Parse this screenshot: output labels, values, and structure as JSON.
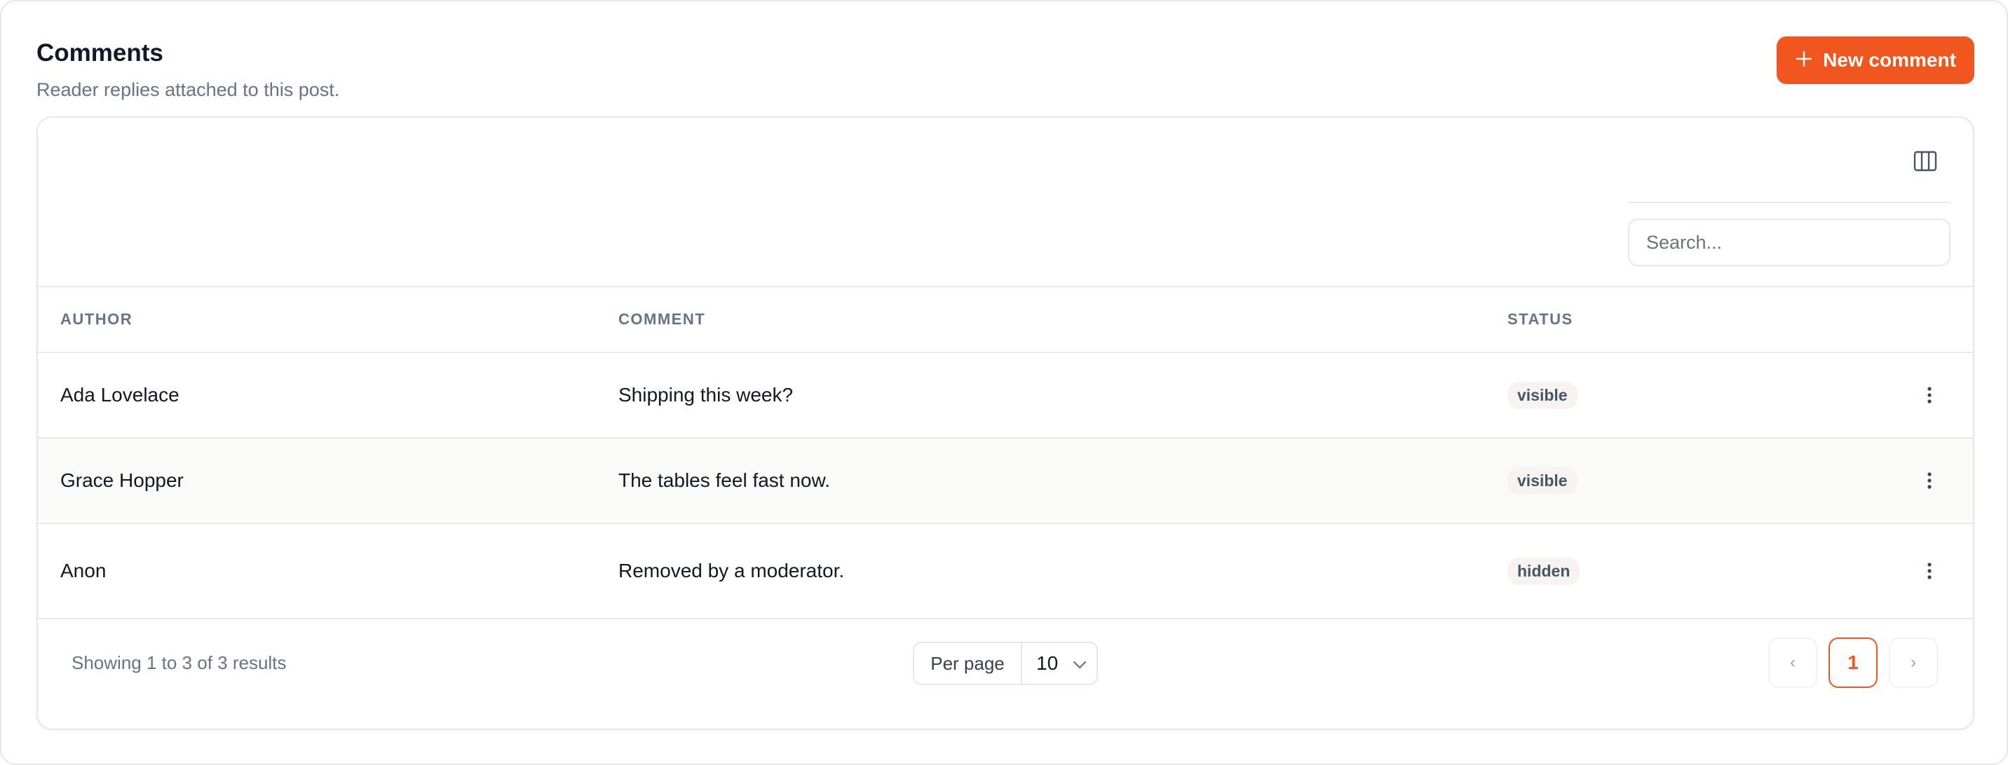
{
  "header": {
    "title": "Comments",
    "subtitle": "Reader replies attached to this post.",
    "new_button_label": "New comment",
    "new_button_icon": "plus-icon"
  },
  "toolbar": {
    "columns_icon": "columns-icon",
    "search_placeholder": "Search..."
  },
  "table": {
    "columns": [
      "AUTHOR",
      "COMMENT",
      "STATUS"
    ],
    "rows": [
      {
        "author": "Ada Lovelace",
        "comment": "Shipping this week?",
        "status": "visible"
      },
      {
        "author": "Grace Hopper",
        "comment": "The tables feel fast now.",
        "status": "visible"
      },
      {
        "author": "Anon",
        "comment": "Removed by a moderator.",
        "status": "hidden"
      }
    ],
    "row_action_icon": "more-vertical-icon"
  },
  "footer": {
    "results_text": "Showing 1 to 3 of 3 results",
    "per_page_label": "Per page",
    "per_page_value": "10",
    "prev_label": "‹",
    "current_page": "1",
    "next_label": "›"
  },
  "colors": {
    "accent": "#f0561d",
    "muted_text": "#64748b",
    "border": "#e5e7eb"
  }
}
